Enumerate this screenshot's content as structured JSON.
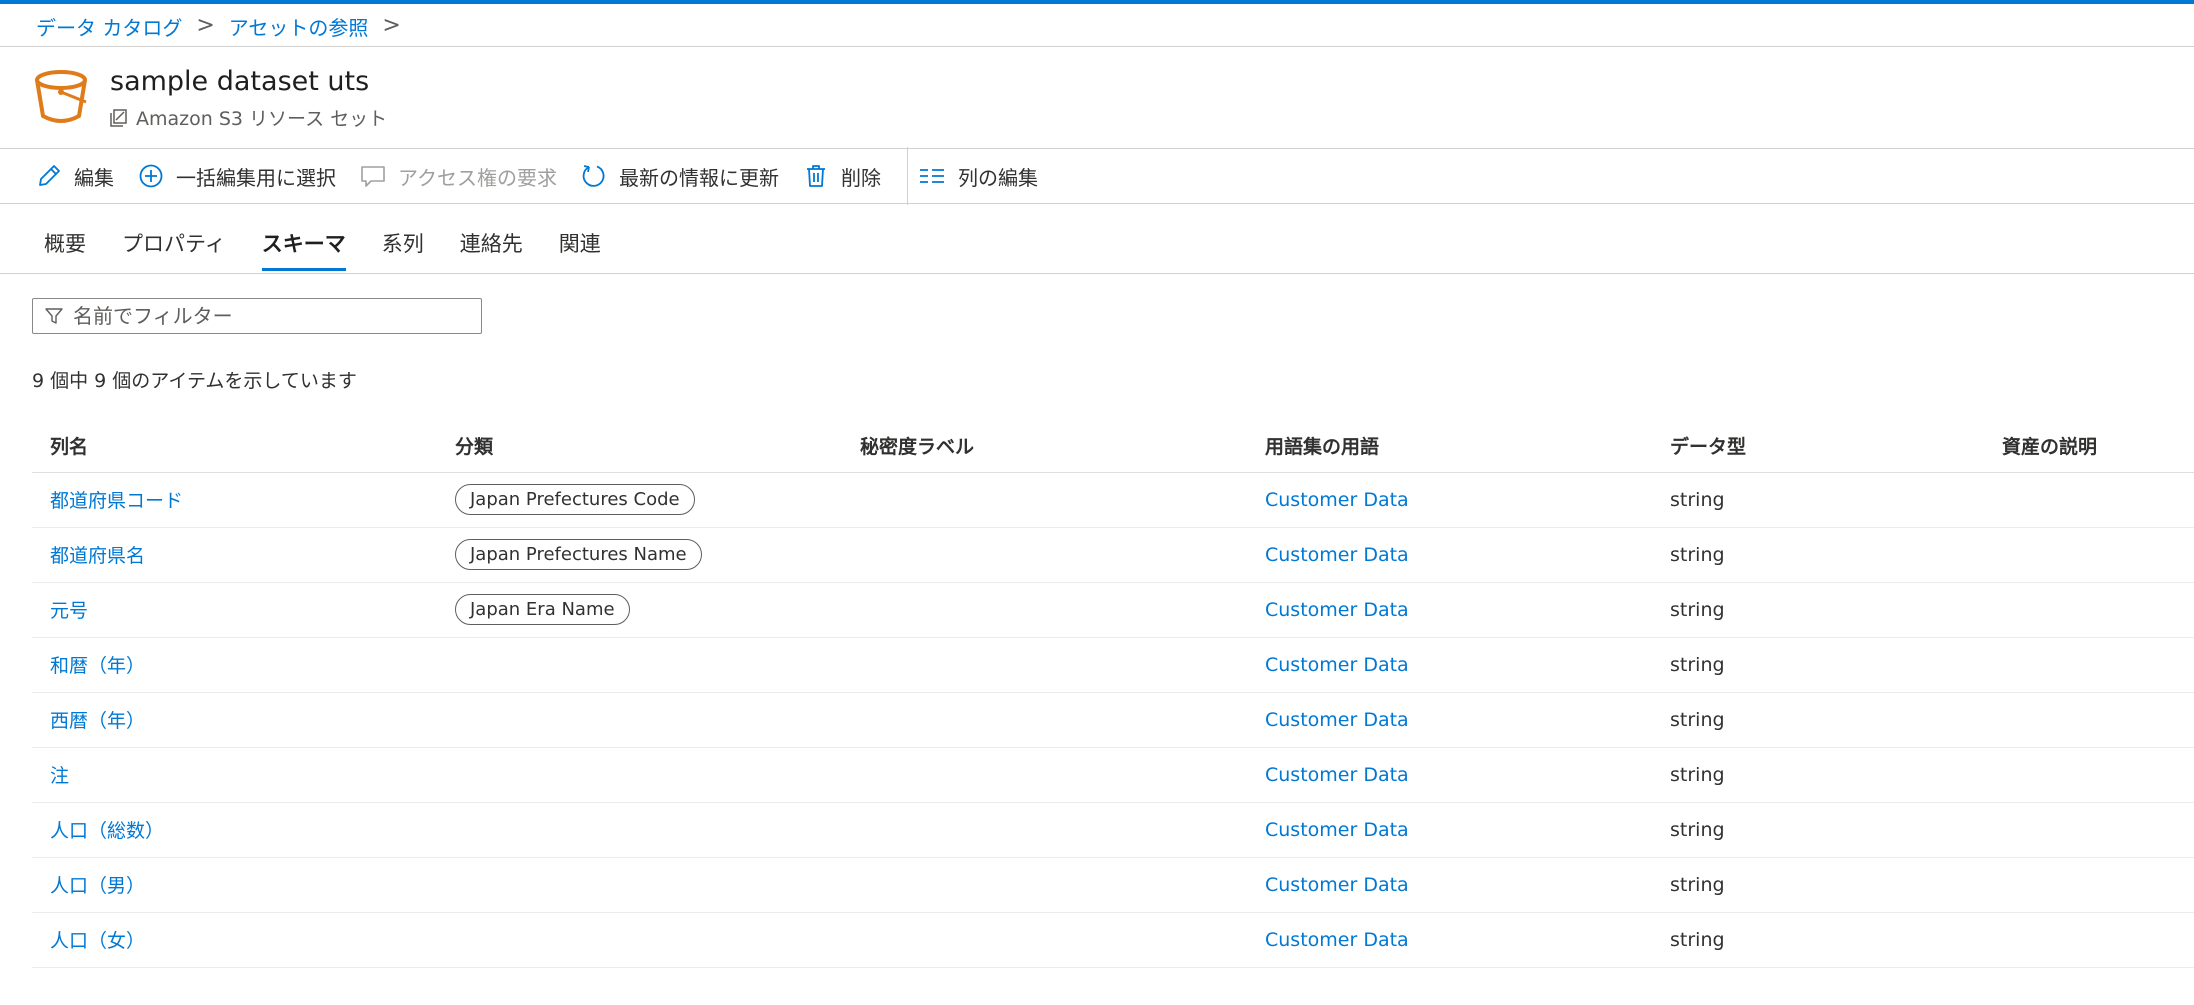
{
  "breadcrumb": {
    "items": [
      "データ カタログ",
      "アセットの参照"
    ],
    "separator": ">"
  },
  "asset": {
    "title": "sample dataset uts",
    "subtitle": "Amazon S3 リソース セット",
    "icon": "s3-bucket-icon",
    "icon_color": "#e07b1a"
  },
  "toolbar": {
    "edit": "編集",
    "bulk_select": "一括編集用に選択",
    "request_access": "アクセス権の要求",
    "refresh": "最新の情報に更新",
    "delete": "削除",
    "edit_columns": "列の編集"
  },
  "tabs": [
    "概要",
    "プロパティ",
    "スキーマ",
    "系列",
    "連絡先",
    "関連"
  ],
  "active_tab": "スキーマ",
  "filter": {
    "placeholder": "名前でフィルター"
  },
  "item_count": "9 個中 9 個のアイテムを示しています",
  "table": {
    "headers": [
      "列名",
      "分類",
      "秘密度ラベル",
      "用語集の用語",
      "データ型",
      "資産の説明"
    ],
    "rows": [
      {
        "name": "都道府県コード",
        "classification": "Japan Prefectures Code",
        "label": "",
        "term": "Customer Data",
        "type": "string",
        "description": ""
      },
      {
        "name": "都道府県名",
        "classification": "Japan Prefectures Name",
        "label": "",
        "term": "Customer Data",
        "type": "string",
        "description": ""
      },
      {
        "name": "元号",
        "classification": "Japan Era Name",
        "label": "",
        "term": "Customer Data",
        "type": "string",
        "description": ""
      },
      {
        "name": "和暦（年）",
        "classification": "",
        "label": "",
        "term": "Customer Data",
        "type": "string",
        "description": ""
      },
      {
        "name": "西暦（年）",
        "classification": "",
        "label": "",
        "term": "Customer Data",
        "type": "string",
        "description": ""
      },
      {
        "name": "注",
        "classification": "",
        "label": "",
        "term": "Customer Data",
        "type": "string",
        "description": ""
      },
      {
        "name": "人口（総数）",
        "classification": "",
        "label": "",
        "term": "Customer Data",
        "type": "string",
        "description": ""
      },
      {
        "name": "人口（男）",
        "classification": "",
        "label": "",
        "term": "Customer Data",
        "type": "string",
        "description": ""
      },
      {
        "name": "人口（女）",
        "classification": "",
        "label": "",
        "term": "Customer Data",
        "type": "string",
        "description": ""
      }
    ]
  },
  "colors": {
    "accent": "#0078d4",
    "text": "#323130",
    "muted": "#a19f9d"
  }
}
